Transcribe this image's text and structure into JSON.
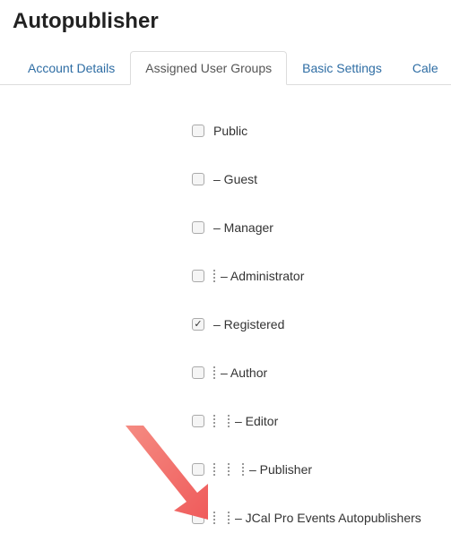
{
  "page_title": "Autopublisher",
  "tabs": [
    {
      "label": "Account Details",
      "active": false
    },
    {
      "label": "Assigned User Groups",
      "active": true
    },
    {
      "label": "Basic Settings",
      "active": false
    },
    {
      "label": "Cale",
      "active": false
    }
  ],
  "groups": [
    {
      "label": "Public",
      "depth": 0,
      "checked": false
    },
    {
      "label": "Guest",
      "depth": 1,
      "checked": false
    },
    {
      "label": "Manager",
      "depth": 1,
      "checked": false
    },
    {
      "label": "Administrator",
      "depth": 2,
      "checked": false
    },
    {
      "label": "Registered",
      "depth": 1,
      "checked": true
    },
    {
      "label": "Author",
      "depth": 2,
      "checked": false
    },
    {
      "label": "Editor",
      "depth": 3,
      "checked": false
    },
    {
      "label": "Publisher",
      "depth": 4,
      "checked": false
    },
    {
      "label": "JCal Pro Events Autopublishers",
      "depth": 3,
      "checked": false
    }
  ],
  "dash_prefix": "– "
}
